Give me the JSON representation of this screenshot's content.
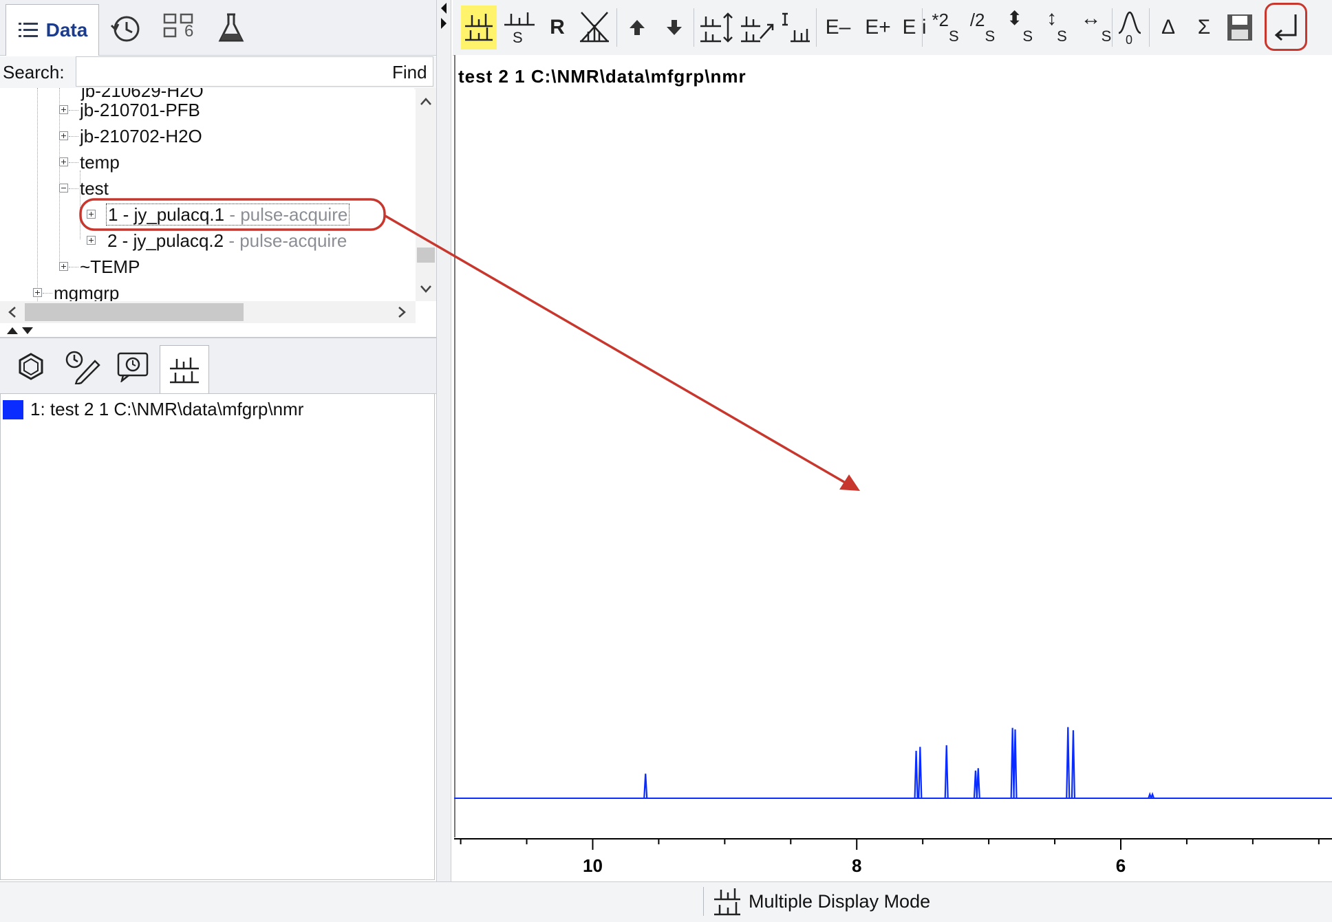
{
  "left_panel": {
    "tabs": [
      {
        "label": "Data",
        "icon": "list-icon"
      },
      {
        "label": "",
        "icon": "history-clock-icon"
      },
      {
        "label": "6",
        "icon": "grid-layout-icon"
      },
      {
        "label": "",
        "icon": "flask-icon"
      }
    ],
    "search": {
      "label": "Search:",
      "value": "",
      "find_label": "Find"
    },
    "tree": [
      {
        "label": "jb-210701-PFB",
        "detail": ""
      },
      {
        "label": "jb-210702-H2O",
        "detail": ""
      },
      {
        "label": "temp",
        "detail": ""
      },
      {
        "label": "test",
        "detail": ""
      },
      {
        "label": "1 - jy_pulacq.1",
        "detail": "- pulse-acquire"
      },
      {
        "label": "2 - jy_pulacq.2",
        "detail": "- pulse-acquire"
      },
      {
        "label": "~TEMP",
        "detail": ""
      },
      {
        "label": "mgmgrp",
        "detail": ""
      }
    ],
    "bottom_tabs": [
      "molecule-icon",
      "edit-pencil-icon",
      "history-chat-icon",
      "spectrum-stack-icon"
    ],
    "spectra_list": [
      {
        "label": "1: test  2  1  C:\\NMR\\data\\mfgrp\\nmr",
        "color": "#0a2cff"
      }
    ]
  },
  "toolbar": {
    "buttons": [
      {
        "label": "",
        "icon": "multiple-display-icon",
        "active": true
      },
      {
        "label": "S",
        "icon": "stacked-display-icon"
      },
      {
        "label": "R",
        "icon": "reference-icon"
      },
      {
        "label": "",
        "icon": "overlay-cross-icon"
      },
      {
        "label": "",
        "icon": "arrow-up-icon"
      },
      {
        "label": "",
        "icon": "arrow-down-icon"
      },
      {
        "label": "",
        "icon": "vertical-expand-icon"
      },
      {
        "label": "",
        "icon": "diagonal-expand-icon"
      },
      {
        "label": "",
        "icon": "integral-display-icon"
      },
      {
        "label": "E–",
        "icon": "scale-decrease-icon"
      },
      {
        "label": "E+",
        "icon": "scale-increase-icon"
      },
      {
        "label": "E i",
        "icon": "scale-individual-icon"
      },
      {
        "label": "*2",
        "sub": "S",
        "icon": "multiply-two-icon"
      },
      {
        "label": "/2",
        "sub": "S",
        "icon": "divide-two-icon"
      },
      {
        "label": "⬍",
        "sub": "S",
        "icon": "vertical-shift-icon"
      },
      {
        "label": "↕",
        "sub": "S",
        "icon": "vertical-offset-icon"
      },
      {
        "label": "↔",
        "sub": "S",
        "icon": "horizontal-offset-icon"
      },
      {
        "label": "",
        "icon": "peak-zero-icon"
      },
      {
        "label": "Δ",
        "icon": "delta-icon"
      },
      {
        "label": "Σ",
        "icon": "sum-icon"
      },
      {
        "label": "",
        "icon": "save-icon"
      },
      {
        "label": "",
        "icon": "return-icon"
      }
    ]
  },
  "plot": {
    "title": "test  2  1  C:\\NMR\\data\\mfgrp\\nmr",
    "spectrum_color": "#0a2cff",
    "annotation_color": "#c8372d"
  },
  "chart_data": {
    "type": "line",
    "title": "test  2  1  C:\\NMR\\data\\mfgrp\\nmr",
    "xlabel": "",
    "ylabel": "",
    "x_reversed": true,
    "xlim": [
      11.05,
      4.4
    ],
    "x_ticks": [
      10,
      8,
      6
    ],
    "tick_labels": [
      "10",
      "8",
      "6"
    ],
    "peaks": [
      {
        "x": 9.6,
        "height": 0.31
      },
      {
        "x": 7.55,
        "height": 0.6
      },
      {
        "x": 7.52,
        "height": 0.65
      },
      {
        "x": 7.32,
        "height": 0.67
      },
      {
        "x": 7.1,
        "height": 0.35
      },
      {
        "x": 7.08,
        "height": 0.38
      },
      {
        "x": 6.82,
        "height": 0.89
      },
      {
        "x": 6.8,
        "height": 0.87
      },
      {
        "x": 6.4,
        "height": 0.9
      },
      {
        "x": 6.36,
        "height": 0.86
      },
      {
        "x": 5.78,
        "height": 0.05
      },
      {
        "x": 5.76,
        "height": 0.05
      }
    ]
  },
  "status_bar": {
    "text": "Multiple Display Mode",
    "icon": "multiple-display-icon"
  }
}
